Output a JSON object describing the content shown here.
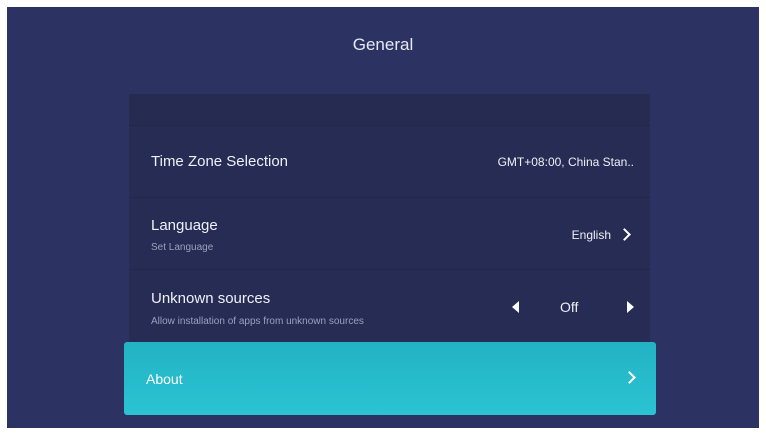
{
  "header": {
    "title": "General"
  },
  "settings": {
    "time_zone": {
      "label": "Time Zone Selection",
      "value": "GMT+08:00, China Stan.."
    },
    "language": {
      "label": "Language",
      "subtitle": "Set Language",
      "value": "English"
    },
    "unknown_sources": {
      "label": "Unknown sources",
      "subtitle": "Allow installation of apps from unknown sources",
      "value": "Off"
    },
    "about": {
      "label": "About"
    }
  },
  "icons": {
    "language_arrow": "chevron-right-icon",
    "unknown_prev": "triangle-left-icon",
    "unknown_next": "triangle-right-icon",
    "about_arrow": "chevron-right-icon"
  },
  "colors": {
    "background": "#2c3363",
    "panel": "#262b52",
    "highlight": "#2bc3d3"
  }
}
